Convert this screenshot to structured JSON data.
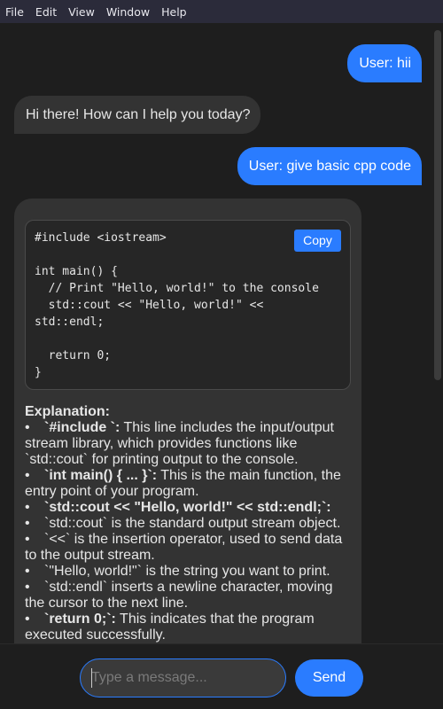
{
  "menubar": {
    "items": [
      "File",
      "Edit",
      "View",
      "Window",
      "Help"
    ]
  },
  "messages": {
    "user1": "User: hii",
    "bot1": "Hi there! How can I help you today?",
    "user2": "User: give basic cpp code",
    "bot2": {
      "code": "#include <iostream>\n\nint main() {\n  // Print \"Hello, world!\" to the console\n  std::cout << \"Hello, world!\" <<\nstd::endl;\n\n  return 0;\n}",
      "copy_label": "Copy",
      "explanation_heading": "Explanation:",
      "items": [
        {
          "bold": "`#include `:",
          "text": " This line includes the input/output stream library, which provides functions like `std::cout` for printing output to the console."
        },
        {
          "bold": "`int main() { ... }`:",
          "text": " This is the main function, the entry point of your program."
        },
        {
          "bold": "`std::cout << \"Hello, world!\" << std::endl;`:",
          "text": ""
        },
        {
          "bold": "",
          "text": "`std::cout` is the standard output stream object."
        },
        {
          "bold": "",
          "text": "`<<` is the insertion operator, used to send data to the output stream."
        },
        {
          "bold": "",
          "text": "`\"Hello, world!\"` is the string you want to print."
        },
        {
          "bold": "",
          "text": "`std::endl` inserts a newline character, moving the cursor to the next line."
        },
        {
          "bold": "`return 0;`:",
          "text": " This indicates that the program executed successfully."
        }
      ]
    }
  },
  "composer": {
    "placeholder": "Type a message...",
    "value": "",
    "send_label": "Send"
  },
  "colors": {
    "accent": "#2a7cff",
    "background": "#1e1e1e",
    "bot_bubble": "#333333",
    "menubar": "#2b2b3a"
  }
}
